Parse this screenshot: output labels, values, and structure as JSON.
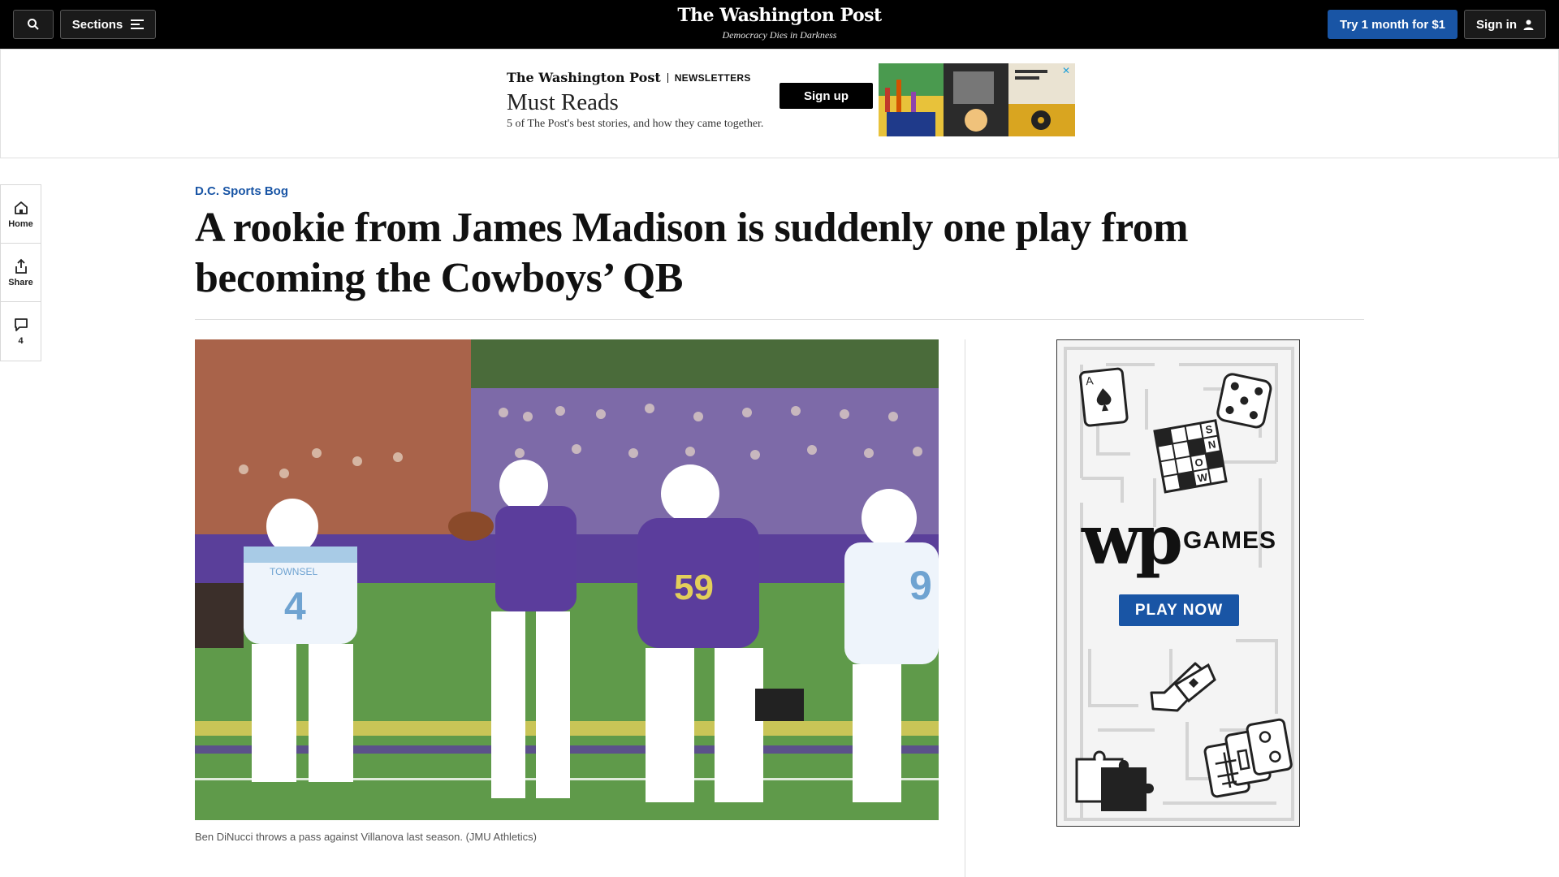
{
  "nav": {
    "sections_label": "Sections",
    "trial_label": "Try 1 month for $1",
    "signin_label": "Sign in",
    "masthead": "The Washington Post",
    "tagline": "Democracy Dies in Darkness"
  },
  "ad_banner": {
    "brand": "The Washington Post",
    "section": "NEWSLETTERS",
    "headline": "Must Reads",
    "description": "5 of The Post's best stories, and how they came together.",
    "cta": "Sign up",
    "close": "✕"
  },
  "rail": {
    "home": "Home",
    "share": "Share",
    "comments_count": "4"
  },
  "article": {
    "kicker": "D.C. Sports Bog",
    "headline": "A rookie from James Madison is suddenly one play from becoming the Cowboys’ QB",
    "caption": "Ben DiNucci throws a pass against Villanova last season. (JMU Athletics)",
    "photo_jersey_numbers": [
      "4",
      "9",
      "59"
    ],
    "photo_name_on_jersey": "TOWNSEL"
  },
  "games_ad": {
    "wordmark": "wp",
    "label": "GAMES",
    "cta": "PLAY NOW",
    "crossword_letters": [
      "S",
      "N",
      "O",
      "W"
    ],
    "card_letter": "A"
  },
  "colors": {
    "accent_blue": "#1955a5",
    "topbar": "#000000",
    "jmu_purple": "#5b3d9c"
  }
}
